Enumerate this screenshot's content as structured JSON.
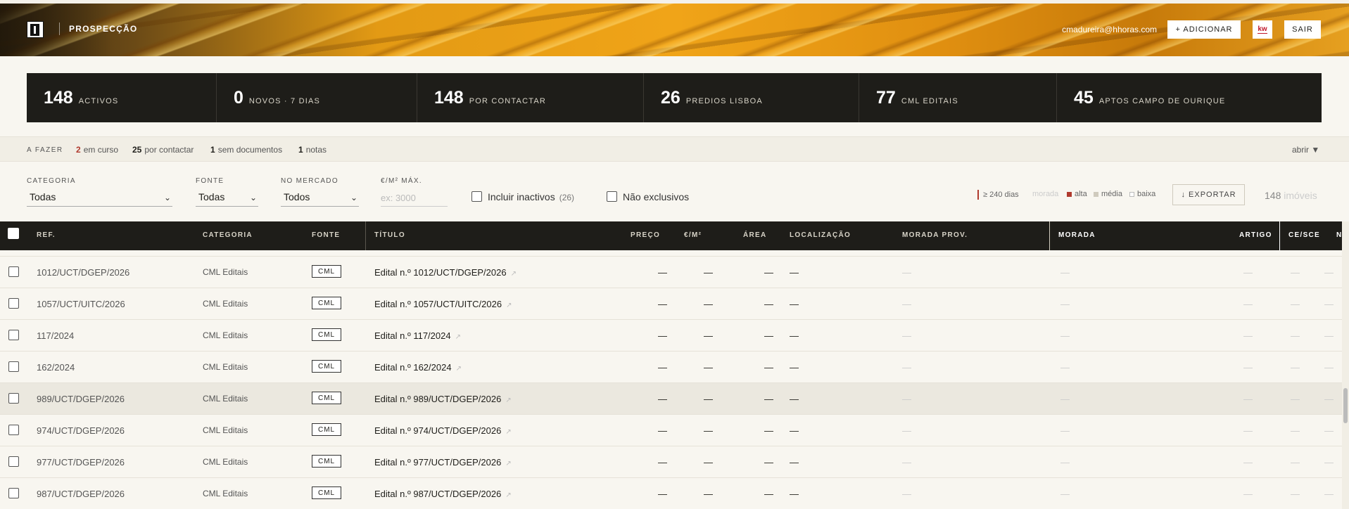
{
  "header": {
    "title": "PROSPECÇÃO",
    "email": "cmadureira@hhoras.com",
    "add_label": "+ ADICIONAR",
    "kw_label": "kw",
    "logout_label": "SAIR"
  },
  "stats": [
    {
      "num": "148",
      "label": "ACTIVOS"
    },
    {
      "num": "0",
      "label": "NOVOS · 7 DIAS"
    },
    {
      "num": "148",
      "label": "POR CONTACTAR"
    },
    {
      "num": "26",
      "label": "PREDIOS LISBOA"
    },
    {
      "num": "77",
      "label": "CML EDITAIS"
    },
    {
      "num": "45",
      "label": "APTOS CAMPO DE OURIQUE"
    }
  ],
  "todo": {
    "label": "A FAZER",
    "items": [
      {
        "num": "2",
        "text": "em curso"
      },
      {
        "num": "25",
        "text": "por contactar"
      },
      {
        "num": "1",
        "text": "sem documentos"
      },
      {
        "num": "1",
        "text": "notas"
      }
    ],
    "open_label": "abrir ▼"
  },
  "filters": {
    "categoria_label": "CATEGORIA",
    "categoria_value": "Todas",
    "fonte_label": "FONTE",
    "fonte_value": "Todas",
    "mercado_label": "NO MERCADO",
    "mercado_value": "Todos",
    "preco_label": "€/M² MÁX.",
    "preco_placeholder": "ex: 3000",
    "inactivos_label": "Incluir inactivos",
    "inactivos_count": "(26)",
    "exclusivos_label": "Não exclusivos",
    "legend_days": "≥ 240 dias",
    "legend_morada": "morada",
    "legend_alta": "alta",
    "legend_media": "média",
    "legend_baixa": "baixa",
    "export_label": "↓ EXPORTAR",
    "count_num": "148",
    "count_unit": "imóveis"
  },
  "colors": {
    "alta": "#b03a2e",
    "media": "#cfcabd",
    "baixa": "#ffffff"
  },
  "table": {
    "headers": {
      "ref": "REF.",
      "categoria": "CATEGORIA",
      "fonte": "FONTE",
      "titulo": "TÍTULO",
      "preco": "PREÇO",
      "preco_m2": "€/M²",
      "area": "ÁREA",
      "localizacao": "LOCALIZAÇÃO",
      "morada_prov": "MORADA PROV.",
      "morada": "MORADA",
      "artigo": "ARTIGO",
      "ce_sce": "CE/SCE",
      "n": "N"
    },
    "dash": "—",
    "rows": [
      {
        "ref": "1012/UCT/DGEP/2026",
        "categoria": "CML Editais",
        "fonte": "CML",
        "titulo": "Edital n.º 1012/UCT/DGEP/2026"
      },
      {
        "ref": "1057/UCT/UITC/2026",
        "categoria": "CML Editais",
        "fonte": "CML",
        "titulo": "Edital n.º 1057/UCT/UITC/2026"
      },
      {
        "ref": "117/2024",
        "categoria": "CML Editais",
        "fonte": "CML",
        "titulo": "Edital n.º 117/2024"
      },
      {
        "ref": "162/2024",
        "categoria": "CML Editais",
        "fonte": "CML",
        "titulo": "Edital n.º 162/2024"
      },
      {
        "ref": "989/UCT/DGEP/2026",
        "categoria": "CML Editais",
        "fonte": "CML",
        "titulo": "Edital n.º 989/UCT/DGEP/2026"
      },
      {
        "ref": "974/UCT/DGEP/2026",
        "categoria": "CML Editais",
        "fonte": "CML",
        "titulo": "Edital n.º 974/UCT/DGEP/2026"
      },
      {
        "ref": "977/UCT/DGEP/2026",
        "categoria": "CML Editais",
        "fonte": "CML",
        "titulo": "Edital n.º 977/UCT/DGEP/2026"
      },
      {
        "ref": "987/UCT/DGEP/2026",
        "categoria": "CML Editais",
        "fonte": "CML",
        "titulo": "Edital n.º 987/UCT/DGEP/2026"
      }
    ]
  }
}
